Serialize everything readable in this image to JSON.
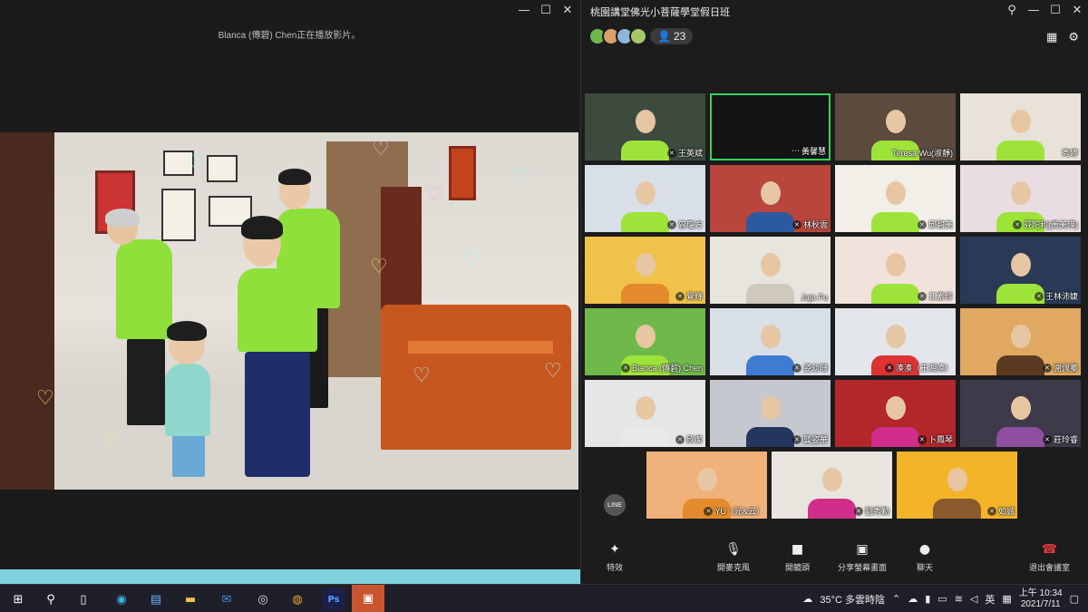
{
  "left_window": {
    "status_text": "Blanca (傳碧) Chen正在播放影片。",
    "controls": [
      "—",
      "☐",
      "✕"
    ]
  },
  "meeting": {
    "title": "桃園講堂佛光小菩薩學堂假日班",
    "participant_count": "23",
    "window_controls": [
      "⚲",
      "—",
      "☐",
      "✕"
    ],
    "tiles": [
      {
        "name": "王英斌",
        "muted": true,
        "bg": "#3d4a3e",
        "shirt": "#9ee33a"
      },
      {
        "name": "黃馨慧",
        "muted": false,
        "bg": "#141414",
        "shirt": "",
        "active": true
      },
      {
        "name": "Teresa Wu(淑靜)",
        "muted": false,
        "bg": "#5b4a3d",
        "shirt": "#9ee33a"
      },
      {
        "name": "秀婷",
        "muted": false,
        "bg": "#e8e2d8",
        "shirt": "#9ee33a"
      },
      {
        "name": "曾瓊方",
        "muted": true,
        "bg": "#d9dfe8",
        "shirt": "#9ee33a"
      },
      {
        "name": "林秋雲",
        "muted": true,
        "bg": "#b8463c",
        "shirt": "#2c5aa0"
      },
      {
        "name": "邱碧美",
        "muted": true,
        "bg": "#f2efe8",
        "shirt": "#9ee33a"
      },
      {
        "name": "芬陀利(黃美瑛)",
        "muted": true,
        "bg": "#e9dde3",
        "shirt": "#9ee33a"
      },
      {
        "name": "覺輝",
        "muted": true,
        "bg": "#f0c24a",
        "shirt": "#e38a2c"
      },
      {
        "name": "Jaja Fu",
        "muted": false,
        "bg": "#e8e4de",
        "shirt": "#cfc8bd"
      },
      {
        "name": "江素珍",
        "muted": true,
        "bg": "#f2e2dc",
        "shirt": "#9ee33a"
      },
      {
        "name": "王林沛婕",
        "muted": true,
        "bg": "#2a3a56",
        "shirt": "#9ee33a"
      },
      {
        "name": "Blanca (傳碧) Chen",
        "muted": true,
        "bg": "#6fb84a",
        "shirt": "#9ee33a"
      },
      {
        "name": "姿幼珊",
        "muted": true,
        "bg": "#d8dfe6",
        "shirt": "#3f7bd0"
      },
      {
        "name": "湊湊（王湘湊）",
        "muted": true,
        "bg": "#e3e6ea",
        "shirt": "#d33"
      },
      {
        "name": "謝佩蓁",
        "muted": true,
        "bg": "#e0a860",
        "shirt": "#5b3a22"
      },
      {
        "name": "欣潔",
        "muted": true,
        "bg": "#e6e6e6",
        "shirt": "#e9e9e9"
      },
      {
        "name": "龔姿華",
        "muted": true,
        "bg": "#c5c9cf",
        "shirt": "#24365e"
      },
      {
        "name": "卜鳳琴",
        "muted": true,
        "bg": "#b3262a",
        "shirt": "#d02e8a"
      },
      {
        "name": "莊玲睿",
        "muted": true,
        "bg": "#3d3a4a",
        "shirt": "#8f4fa0"
      },
      {
        "name": "YU（元&云）",
        "muted": true,
        "bg": "#f0b27a",
        "shirt": "#e38a2c"
      },
      {
        "name": "劉秀勤",
        "muted": true,
        "bg": "#e8e4de",
        "shirt": "#d02e8a"
      },
      {
        "name": "如誠",
        "muted": true,
        "bg": "#f4b42a",
        "shirt": "#8a5a2c"
      }
    ],
    "toolbar": {
      "effects": "特效",
      "unmute": "開麥克風",
      "camera": "開鏡頭",
      "share": "分享螢幕畫面",
      "chat": "聊天",
      "leave": "退出會議室"
    },
    "line_badge": "LINE"
  },
  "taskbar": {
    "weather": "35°C 多雲時陰",
    "ime": "英",
    "time": "上午 10:34",
    "date": "2021/7/11"
  },
  "colors": {
    "accent_green": "#35d35a",
    "leave_red": "#e03b3b",
    "line_app": "#c8552f"
  }
}
